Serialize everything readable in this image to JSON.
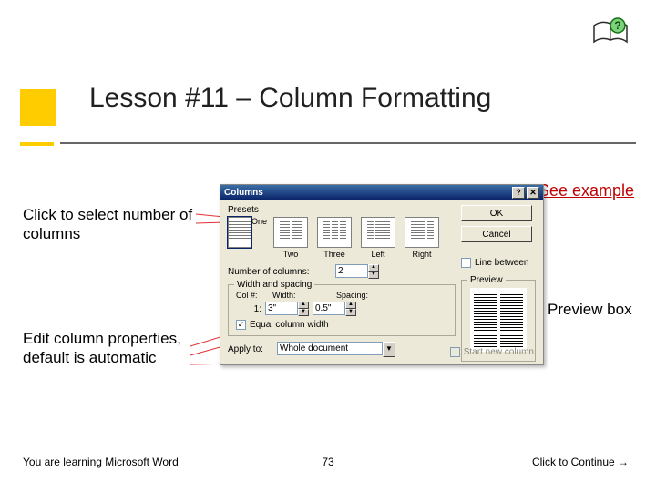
{
  "title": "Lesson #11 – Column Formatting",
  "see_example": "See example",
  "captions": {
    "select_columns": "Click to select number of columns",
    "edit_props": "Edit column properties, default is automatic",
    "preview": "Preview box"
  },
  "footer": {
    "left": "You are learning Microsoft Word",
    "page": "73",
    "right": "Click to Continue →"
  },
  "help_icon_name": "help-book-icon",
  "dialog": {
    "title": "Columns",
    "ok": "OK",
    "cancel": "Cancel",
    "presets_label": "Presets",
    "presets": [
      {
        "key": "one",
        "label": "One"
      },
      {
        "key": "two",
        "label": "Two"
      },
      {
        "key": "three",
        "label": "Three"
      },
      {
        "key": "left",
        "label": "Left"
      },
      {
        "key": "right",
        "label": "Right"
      }
    ],
    "num_columns_label": "Number of columns:",
    "num_columns_value": "2",
    "line_between_label": "Line between",
    "line_between_checked": false,
    "ws": {
      "legend": "Width and spacing",
      "col_header": "Col #:",
      "width_header": "Width:",
      "spacing_header": "Spacing:",
      "rows": [
        {
          "col": "1:",
          "width": "3\"",
          "spacing": "0.5\""
        }
      ],
      "equal_label": "Equal column width",
      "equal_checked": true
    },
    "preview_legend": "Preview",
    "apply_to_label": "Apply to:",
    "apply_to_value": "Whole document",
    "start_new_label": "Start new column",
    "start_new_enabled": false
  }
}
